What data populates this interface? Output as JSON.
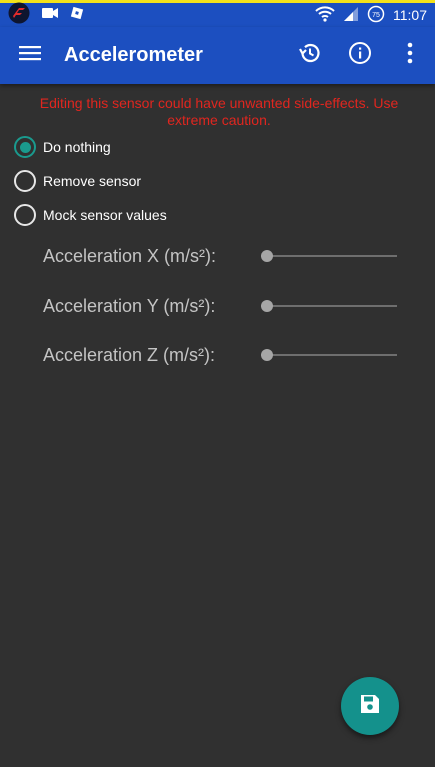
{
  "status_bar": {
    "time": "11:07",
    "battery_level": "75",
    "icons": [
      "app-logo-icon",
      "video-camera-icon",
      "roblox-icon",
      "wifi-icon",
      "signal-icon",
      "battery-icon"
    ]
  },
  "app_bar": {
    "title": "Accelerometer",
    "icons": [
      "menu-icon",
      "history-icon",
      "info-icon",
      "more-vert-icon"
    ]
  },
  "warning": "Editing this sensor could have unwanted side-effects. Use extreme caution.",
  "options": [
    {
      "label": "Do nothing",
      "checked": true
    },
    {
      "label": "Remove sensor",
      "checked": false
    },
    {
      "label": "Mock sensor values",
      "checked": false
    }
  ],
  "sliders": [
    {
      "label": "Acceleration X (m/s²):",
      "value": 0
    },
    {
      "label": "Acceleration Y (m/s²):",
      "value": 0
    },
    {
      "label": "Acceleration Z (m/s²):",
      "value": 0
    }
  ],
  "fab": {
    "icon": "save-icon"
  },
  "colors": {
    "app_bar": "#1c4fc0",
    "background": "#303030",
    "warning": "#e0261f",
    "accent": "#14918c",
    "top_strip": "#f4e21a"
  }
}
